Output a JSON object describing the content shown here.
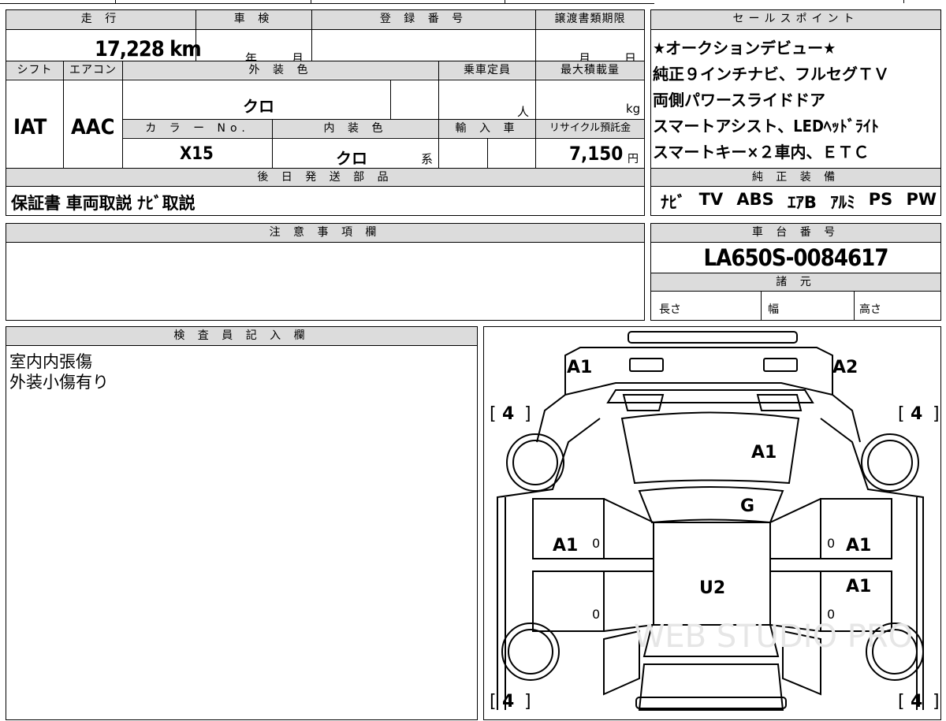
{
  "top": {
    "h_mileage": "走 行",
    "mileage": "17,228 km",
    "h_shaken": "車 検",
    "shaken_year": "年",
    "shaken_month": "月",
    "h_reg": "登 録 番 号",
    "h_transfer": "譲渡書類期限",
    "transfer_month": "月",
    "transfer_day": "日",
    "h_shift": "シフト",
    "shift": "IAT",
    "h_ac": "エアコン",
    "ac": "AAC",
    "h_exterior": "外 装 色",
    "exterior": "クロ",
    "h_capacity": "乗車定員",
    "capacity_unit": "人",
    "h_load": "最大積載量",
    "load_unit": "kg",
    "h_color_no": "カ ラ ー No.",
    "color_no": "X15",
    "h_interior": "内 装 色",
    "interior": "クロ",
    "interior_suffix": "系",
    "h_import": "輸 入 車",
    "h_recycle": "リサイクル預託金",
    "recycle": "7,150",
    "recycle_unit": "円",
    "h_later_parts": "後 日 発 送 部 品",
    "later_parts": "保証書 車両取説 ﾅﾋﾞ取説"
  },
  "sales": {
    "h": "セールスポイント",
    "lines": [
      "★オークションデビュー★",
      "純正９インチナビ、フルセグＴＶ",
      "両側パワースライドドア",
      "スマートアシスト、LEDﾍｯﾄﾞﾗｲﾄ",
      "スマートキー×２車内、ＥＴＣ"
    ]
  },
  "equipment": {
    "h": "純 正 装 備",
    "items": [
      "ﾅﾋﾞ",
      "TV",
      "ABS",
      "ｴｱB",
      "ｱﾙﾐ",
      "PS",
      "PW"
    ]
  },
  "notes": {
    "h": "注 意 事 項 欄"
  },
  "chassis": {
    "h": "車 台 番 号",
    "number": "LA650S-0084617"
  },
  "specs": {
    "h": "諸 元",
    "length": "長さ",
    "width": "幅",
    "height": "高さ"
  },
  "inspector": {
    "h": "検 査 員 記 入 欄",
    "lines": [
      "室内内張傷",
      "外装小傷有り"
    ]
  },
  "diagram": {
    "marks": {
      "front_left": "A1",
      "front_right": "A2",
      "hood": "A1",
      "windshield": "G",
      "left_front_door": "A1",
      "right_front_door": "A1",
      "right_rear_door": "A1",
      "roof": "U2"
    },
    "tires": {
      "fl": "4",
      "fr": "4",
      "rl": "4",
      "rr": "4"
    },
    "zeros": [
      "0",
      "0",
      "0",
      "0"
    ],
    "watermark": "WEB STUDIO PRO"
  }
}
